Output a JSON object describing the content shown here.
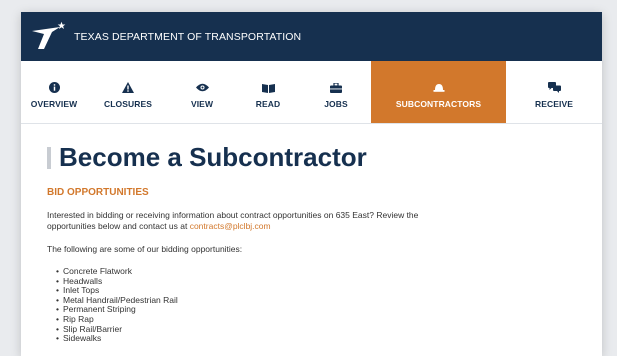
{
  "header": {
    "agency_name": "TEXAS DEPARTMENT OF TRANSPORTATION"
  },
  "nav": {
    "items": [
      {
        "label": "OVERVIEW",
        "icon": "info-icon"
      },
      {
        "label": "CLOSURES",
        "icon": "warning-icon"
      },
      {
        "label": "VIEW",
        "icon": "eye-icon"
      },
      {
        "label": "READ",
        "icon": "book-icon"
      },
      {
        "label": "JOBS",
        "icon": "briefcase-icon"
      },
      {
        "label": "SUBCONTRACTORS",
        "icon": "hardhat-icon",
        "active": true
      },
      {
        "label": "RECEIVE",
        "icon": "chat-icon"
      }
    ]
  },
  "main": {
    "title": "Become a Subcontractor",
    "section_heading": "BID OPPORTUNITIES",
    "intro_text": "Interested in bidding or receiving information about contract opportunities on 635 East?  Review the opportunities below and contact us at ",
    "email": "contracts@plclbj.com",
    "list_intro": "The following are some of our bidding opportunities:",
    "opportunities": [
      "Concrete Flatwork",
      "Headwalls",
      "Inlet Tops",
      "Metal Handrail/Pedestrian Rail",
      "Permanent Striping",
      "Rip Rap",
      "Slip Rail/Barrier",
      "Sidewalks"
    ]
  },
  "colors": {
    "header_bg": "#16304f",
    "accent": "#d2782c",
    "title": "#16304f"
  }
}
